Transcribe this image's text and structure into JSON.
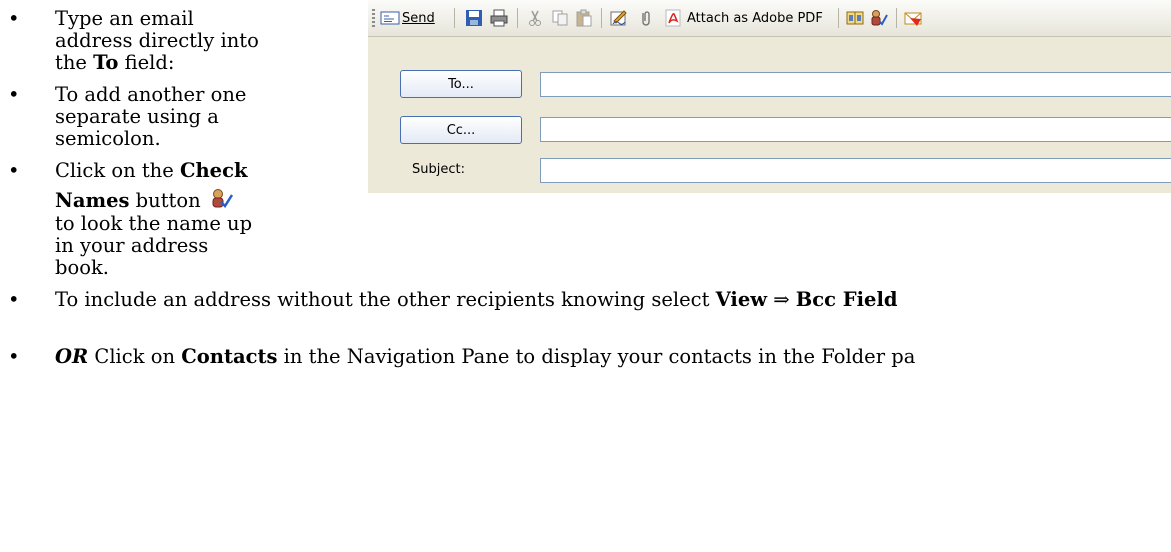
{
  "bullets": [
    {
      "lines": [
        "Type an email",
        "address directly into"
      ],
      "line3_prefix": "the ",
      "line3_bold": "To",
      "line3_suffix": " field:"
    },
    {
      "lines": [
        "To add another one",
        "separate using a",
        "semicolon."
      ]
    },
    {
      "prefix": "Click on the ",
      "bold1": "Check",
      "bold2": "Names",
      "suffix2": " button",
      "lines": [
        "to look the name up",
        "in your address",
        "book."
      ]
    },
    {
      "prefix": "To include an address without the other recipients knowing select ",
      "bold_view": "View",
      "arrow": "⇒",
      "bold_bcc": "Bcc Field"
    },
    {
      "or": "OR",
      "t1": " Click on ",
      "bold": "Contacts",
      "t2": " in the Navigation Pane to display your contacts in the Folder pa"
    }
  ],
  "toolbar": {
    "send": "Send",
    "attach_pdf": "Attach as Adobe PDF"
  },
  "form": {
    "to_button": "To...",
    "cc_button": "Cc...",
    "subject_label": "Subject:"
  }
}
